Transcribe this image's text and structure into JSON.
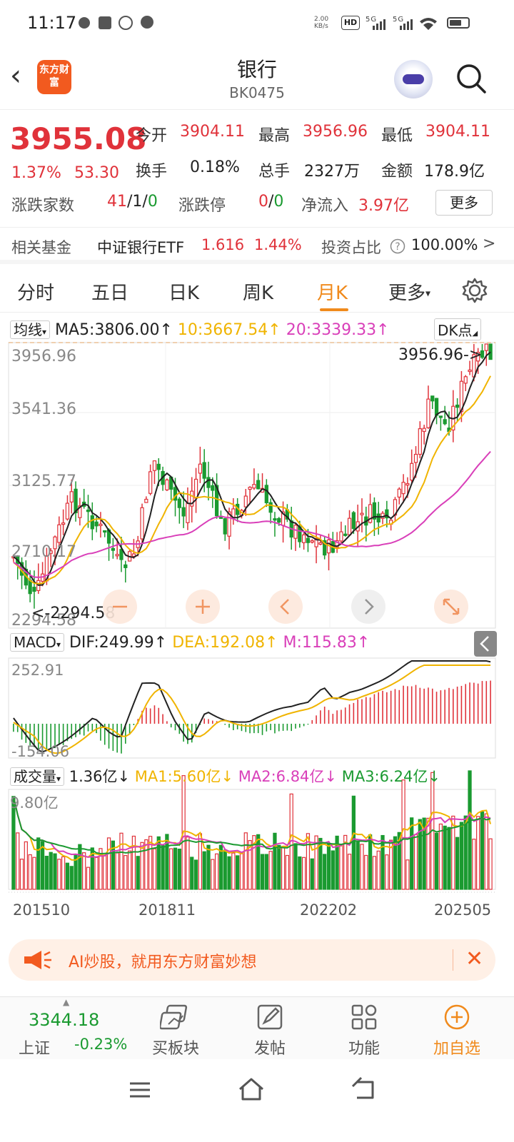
{
  "status_bar": {
    "time": "11:17",
    "net_speed": "2.00",
    "net_unit": "KB/s",
    "hd": "HD",
    "sig1": "5G",
    "sig2": "5G"
  },
  "header": {
    "back_glyph": "‹",
    "logo_text": "东方财富",
    "title": "银行",
    "code": "BK0475"
  },
  "quote": {
    "price": "3955.08",
    "change_pct": "1.37%",
    "change_abs": "53.30",
    "open_label": "今开",
    "open": "3904.11",
    "high_label": "最高",
    "high": "3956.96",
    "low_label": "最低",
    "low": "3904.11",
    "turnover_label": "换手",
    "turnover": "0.18%",
    "volume_label": "总手",
    "volume": "2327万",
    "amount_label": "金额",
    "amount": "178.9亿",
    "updown_label": "涨跌家数",
    "up": "41",
    "flat": "1",
    "down": "0",
    "limit_label": "涨跌停",
    "limit_up": "0",
    "limit_down": "0",
    "netflow_label": "净流入",
    "netflow": "3.97亿",
    "more_label": "更多"
  },
  "fund": {
    "label": "相关基金",
    "name": "中证银行ETF",
    "price": "1.616",
    "pct": "1.44%",
    "ratio_label": "投资占比",
    "ratio": "100.00%",
    "arrow": ">"
  },
  "tabs": [
    "分时",
    "五日",
    "日K",
    "周K",
    "月K",
    "更多"
  ],
  "active_tab": "月K",
  "kline": {
    "ma_select": "均线",
    "ma5": "MA5:3806.00↑",
    "ma10": "10:3667.54↑",
    "ma20": "20:3339.33↑",
    "dk": "DK点",
    "y_labels": [
      "3956.96",
      "3541.36",
      "3125.77",
      "2710.17",
      "2294.58"
    ],
    "max_marker": "3956.96->",
    "min_marker": "<-2294.58"
  },
  "macd": {
    "select": "MACD",
    "dif": "DIF:249.99↑",
    "dea": "DEA:192.08↑",
    "m": "M:115.83↑",
    "y_top": "252.91",
    "y_bottom": "-154.06"
  },
  "volume": {
    "select": "成交量",
    "value": "1.36亿↓",
    "ma1": "MA1:5.60亿↓",
    "ma2": "MA2:6.84亿↓",
    "ma3": "MA3:6.24亿↓",
    "y_top": "9.80亿"
  },
  "x_labels": [
    "201510",
    "201811",
    "202202",
    "202505"
  ],
  "ai_banner": {
    "text": "AI炒股，就用东方财富妙想",
    "close": "✕"
  },
  "toolbar": {
    "index_value": "3344.18",
    "index_name": "上证",
    "index_pct": "-0.23%",
    "buy_sector": "买板块",
    "post": "发帖",
    "function": "功能",
    "add_watch": "加自选"
  },
  "colors": {
    "up": "#e0323a",
    "down": "#1a9a30",
    "accent": "#f08a1c",
    "ma10": "#f0b400",
    "ma20": "#d93fb9"
  }
}
